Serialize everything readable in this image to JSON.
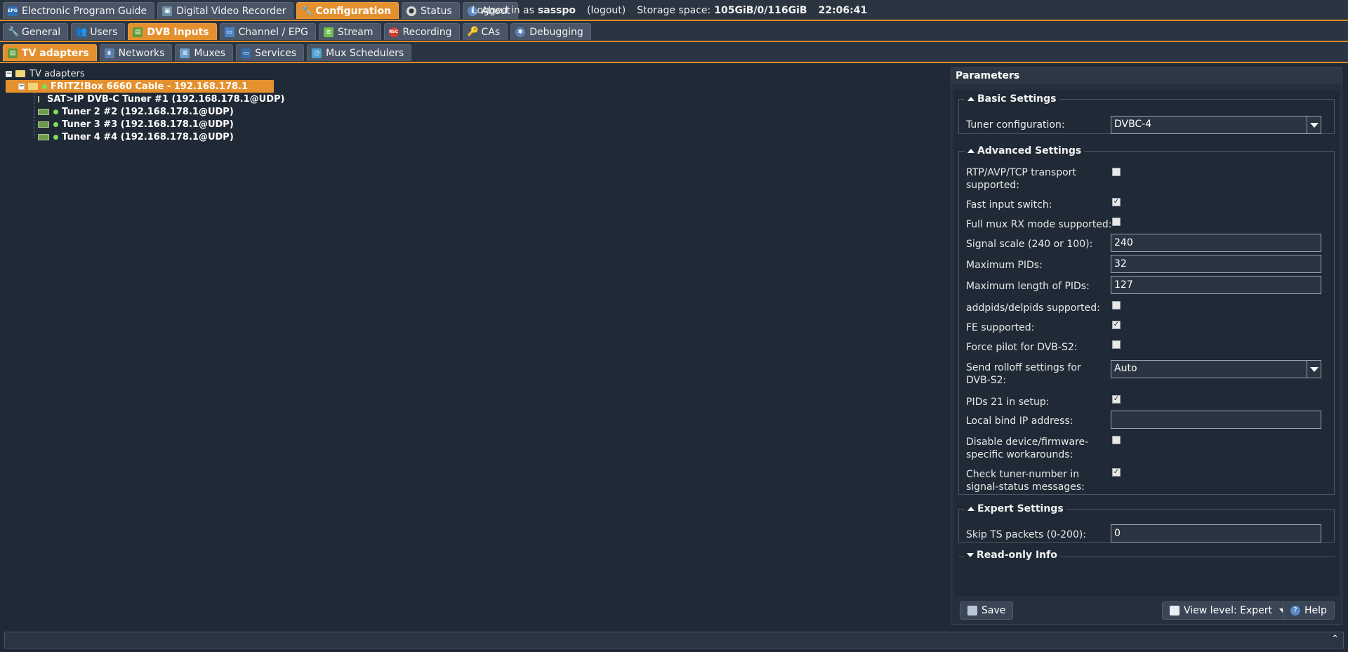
{
  "top_tabs": [
    {
      "label": "Electronic Program Guide",
      "icon": "epg-icon",
      "icon_text": "EPG"
    },
    {
      "label": "Digital Video Recorder",
      "icon": "dvr-icon"
    },
    {
      "label": "Configuration",
      "icon": "wrench-icon",
      "active": true
    },
    {
      "label": "Status",
      "icon": "eye-icon"
    },
    {
      "label": "About",
      "icon": "info-icon"
    }
  ],
  "status": {
    "logged_in_prefix": "Logged in as",
    "user": "sasspo",
    "logout": "(logout)",
    "storage_label": "Storage space:",
    "storage_value": "105GiB/0/116GiB",
    "time": "22:06:41"
  },
  "config_tabs": [
    {
      "label": "General",
      "icon": "wrench-icon"
    },
    {
      "label": "Users",
      "icon": "users-icon"
    },
    {
      "label": "DVB Inputs",
      "icon": "card-icon",
      "active": true
    },
    {
      "label": "Channel / EPG",
      "icon": "tv-icon"
    },
    {
      "label": "Stream",
      "icon": "stream-icon"
    },
    {
      "label": "Recording",
      "icon": "rec-icon",
      "icon_text": "REC"
    },
    {
      "label": "CAs",
      "icon": "key-icon"
    },
    {
      "label": "Debugging",
      "icon": "bug-icon"
    }
  ],
  "dvb_tabs": [
    {
      "label": "TV adapters",
      "icon": "card-icon",
      "active": true
    },
    {
      "label": "Networks",
      "icon": "network-icon"
    },
    {
      "label": "Muxes",
      "icon": "mux-icon"
    },
    {
      "label": "Services",
      "icon": "services-icon"
    },
    {
      "label": "Mux Schedulers",
      "icon": "scheduler-icon"
    }
  ],
  "tree": {
    "root": "TV adapters",
    "adapter": "FRITZ!Box 6660 Cable - 192.168.178.1",
    "tuners": [
      "SAT>IP DVB-C Tuner #1 (192.168.178.1@UDP)",
      "Tuner 2 #2 (192.168.178.1@UDP)",
      "Tuner 3 #3 (192.168.178.1@UDP)",
      "Tuner 4 #4 (192.168.178.1@UDP)"
    ]
  },
  "params": {
    "title": "Parameters",
    "basic": {
      "legend": "Basic Settings",
      "tuner_config_label": "Tuner configuration:",
      "tuner_config_value": "DVBC-4"
    },
    "advanced": {
      "legend": "Advanced Settings",
      "rtp_label": "RTP/AVP/TCP transport supported:",
      "rtp_checked": false,
      "fast_switch_label": "Fast input switch:",
      "fast_switch_checked": true,
      "full_mux_label": "Full mux RX mode supported:",
      "full_mux_checked": false,
      "signal_scale_label": "Signal scale (240 or 100):",
      "signal_scale_value": "240",
      "max_pids_label": "Maximum PIDs:",
      "max_pids_value": "32",
      "max_len_label": "Maximum length of PIDs:",
      "max_len_value": "127",
      "addpids_label": "addpids/delpids supported:",
      "addpids_checked": false,
      "fe_label": "FE supported:",
      "fe_checked": true,
      "pilot_label": "Force pilot for DVB-S2:",
      "pilot_checked": false,
      "rolloff_label": "Send rolloff settings for DVB-S2:",
      "rolloff_value": "Auto",
      "pids21_label": "PIDs 21 in setup:",
      "pids21_checked": true,
      "bind_ip_label": "Local bind IP address:",
      "bind_ip_value": "",
      "disable_wa_label": "Disable device/firmware-specific workarounds:",
      "disable_wa_checked": false,
      "tuner_number_label": "Check tuner-number in signal-status messages:",
      "tuner_number_checked": true
    },
    "expert": {
      "legend": "Expert Settings",
      "skip_ts_label": "Skip TS packets (0-200):",
      "skip_ts_value": "0"
    },
    "readonly": {
      "legend": "Read-only Info"
    },
    "save": "Save",
    "view_level": "View level: Expert",
    "help": "Help"
  },
  "colors": {
    "accent": "#e5902f",
    "background": "#202a36",
    "status_ok": "#7ee05a"
  }
}
